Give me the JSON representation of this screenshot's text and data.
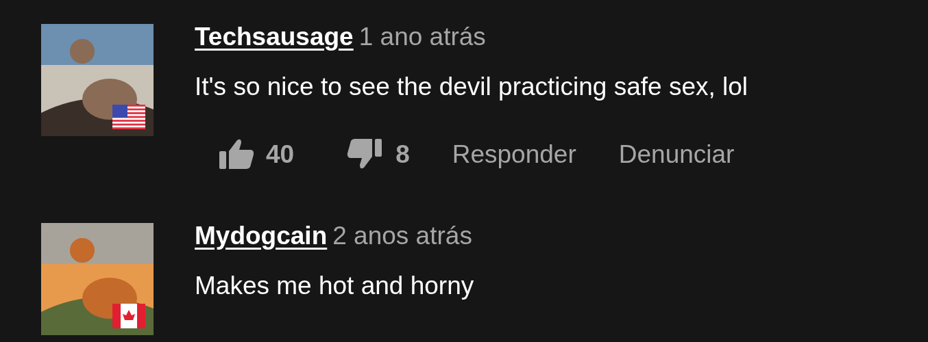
{
  "comments": [
    {
      "avatar": {
        "kind": "picture",
        "flag": {
          "kind": "us"
        }
      },
      "username": "Techsausage",
      "time": "1 ano atrás",
      "text": "It's so nice to see the devil practicing safe sex, lol",
      "likes": "40",
      "dislikes": "8",
      "reply": "Responder",
      "report": "Denunciar"
    },
    {
      "avatar": {
        "kind": "picture",
        "flag": {
          "kind": "ca"
        }
      },
      "username": "Mydogcain",
      "time": "2 anos atrás",
      "text": "Makes me hot and horny"
    }
  ]
}
